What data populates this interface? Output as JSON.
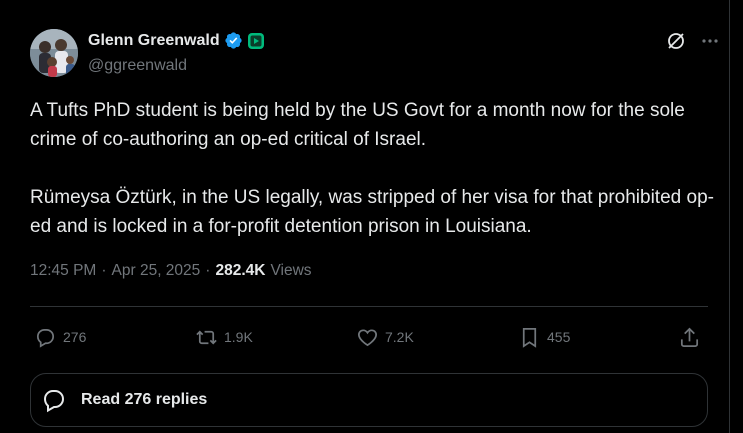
{
  "author": {
    "name": "Glenn Greenwald",
    "handle": "@ggreenwald",
    "verified_color": "#1d9bf0",
    "badge_color": "#00ba7c",
    "icons": [
      "verified-badge-icon",
      "subscription-badge-icon"
    ]
  },
  "header_actions": {
    "icons": [
      "grok-icon",
      "more-icon"
    ]
  },
  "post": {
    "text": "A Tufts PhD student is being held by the US Govt for a month now for the sole crime of co-authoring an op-ed critical of Israel.\n\nRümeysa Öztürk, in the US legally, was stripped of her visa for that prohibited op-ed and is locked in a for-profit detention prison in Louisiana.",
    "time": "12:45 PM",
    "separator": "·",
    "date": "Apr 25, 2025",
    "views_count": "282.4K",
    "views_label": "Views"
  },
  "actions": {
    "reply_count": "276",
    "repost_count": "1.9K",
    "like_count": "7.2K",
    "bookmark_count": "455",
    "icon_color": "#71767b"
  },
  "replies_bar": {
    "label": "Read 276 replies"
  }
}
